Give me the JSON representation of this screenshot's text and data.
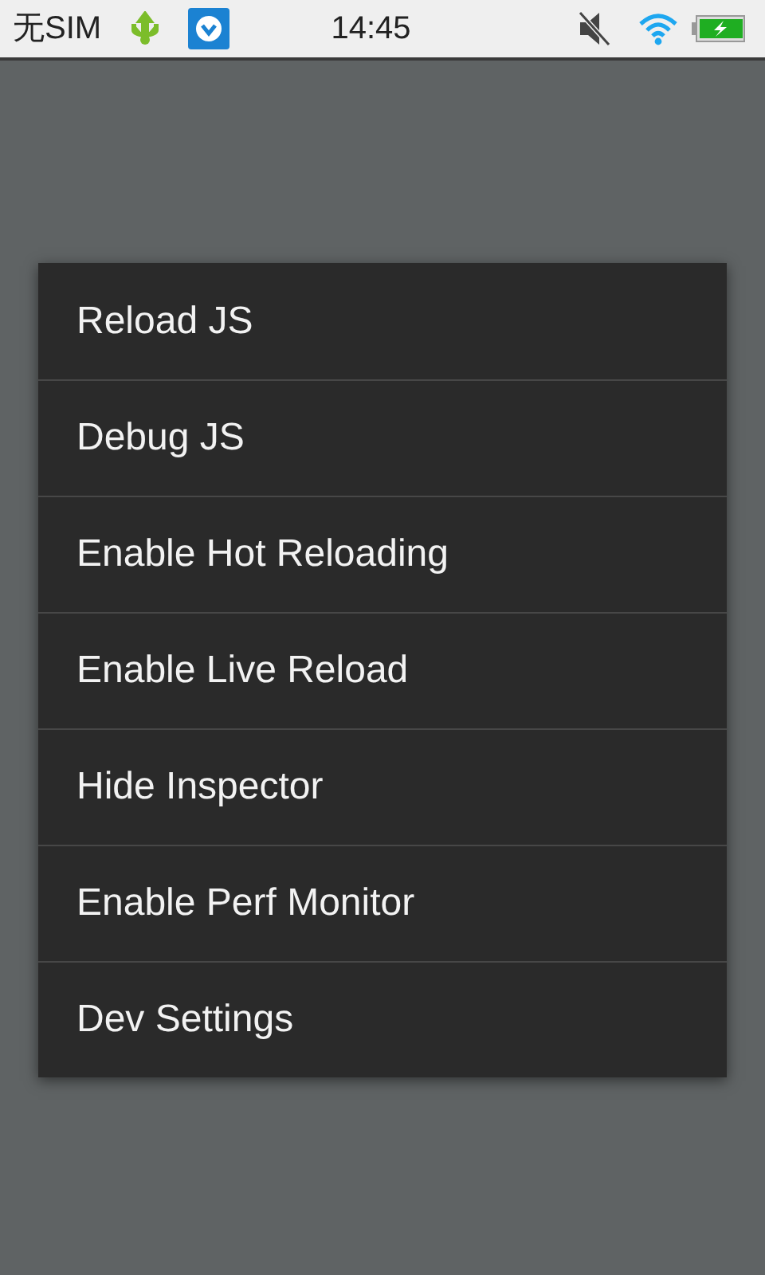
{
  "status_bar": {
    "carrier": "无SIM",
    "time": "14:45"
  },
  "menu": {
    "items": [
      {
        "label": "Reload JS"
      },
      {
        "label": "Debug JS"
      },
      {
        "label": "Enable Hot Reloading"
      },
      {
        "label": "Enable Live Reload"
      },
      {
        "label": "Hide Inspector"
      },
      {
        "label": "Enable Perf Monitor"
      },
      {
        "label": "Dev Settings"
      }
    ]
  }
}
